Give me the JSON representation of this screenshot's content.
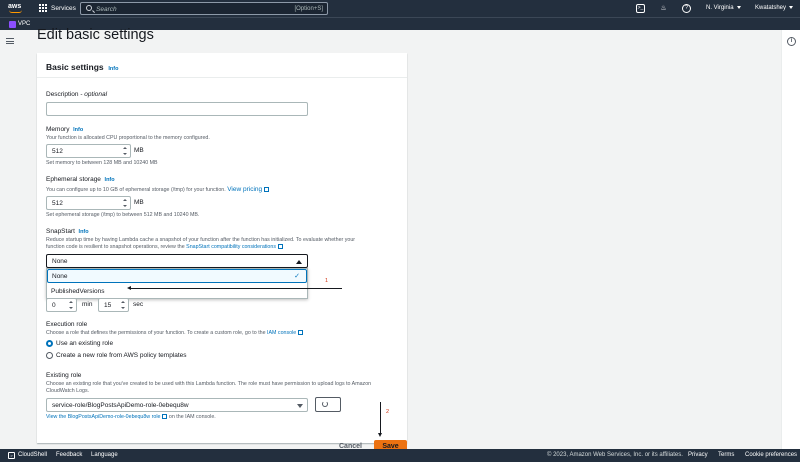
{
  "topnav": {
    "logo_text": "aws",
    "services_label": "Services",
    "search_placeholder": "Search",
    "search_shortcut": "[Option+S]",
    "region": "N. Virginia",
    "user": "Kwatatshey"
  },
  "subbar": {
    "service_label": "VPC"
  },
  "page_title": "Edit basic settings",
  "card": {
    "title": "Basic settings",
    "title_info": "Info",
    "description": {
      "label": "Description - ",
      "label_optional": "optional",
      "value": ""
    },
    "memory": {
      "label": "Memory",
      "info": "Info",
      "desc": "Your function is allocated CPU proportional to the memory configured.",
      "value": "512",
      "unit": "MB",
      "constraint": "Set memory to between 128 MB and 10240 MB"
    },
    "ephemeral": {
      "label": "Ephemeral storage",
      "info": "Info",
      "desc": "You can configure up to 10 GB of ephemeral storage (/tmp) for your function.",
      "link": "View pricing",
      "value": "512",
      "unit": "MB",
      "constraint": "Set ephemeral storage (/tmp) to between 512 MB and 10240 MB."
    },
    "snapstart": {
      "label": "SnapStart",
      "info": "Info",
      "desc_1": "Reduce startup time by having Lambda cache a snapshot of your function after the function has initialized. To evaluate whether your",
      "desc_2": "function code is resilient to snapshot operations, review the",
      "link": "SnapStart compatibility considerations",
      "selected": "None",
      "options": [
        "None",
        "PublishedVersions"
      ]
    },
    "timeout": {
      "min_value": "0",
      "min_unit": "min",
      "sec_value": "15",
      "sec_unit": "sec"
    },
    "execution_role": {
      "label": "Execution role",
      "desc": "Choose a role that defines the permissions of your function. To create a custom role, go to the",
      "link": "IAM console",
      "option_existing": "Use an existing role",
      "option_new": "Create a new role from AWS policy templates"
    },
    "existing_role": {
      "label": "Existing role",
      "desc_1": "Choose an existing role that you've created to be used with this Lambda function. The role must have permission to upload logs to Amazon",
      "desc_2": "CloudWatch Logs.",
      "value": "service-role/BlogPostsApiDemo-role-0ebequ8w",
      "view_link": "View the BlogPostsApiDemo-role-0ebequ8w role",
      "view_suffix": "on the IAM console."
    }
  },
  "annotations": {
    "one": "1",
    "two": "2"
  },
  "actions": {
    "cancel": "Cancel",
    "save": "Save"
  },
  "footer": {
    "cloudshell": "CloudShell",
    "feedback": "Feedback",
    "language": "Language",
    "copyright": "© 2023, Amazon Web Services, Inc. or its affiliates.",
    "privacy": "Privacy",
    "terms": "Terms",
    "cookie": "Cookie preferences"
  }
}
